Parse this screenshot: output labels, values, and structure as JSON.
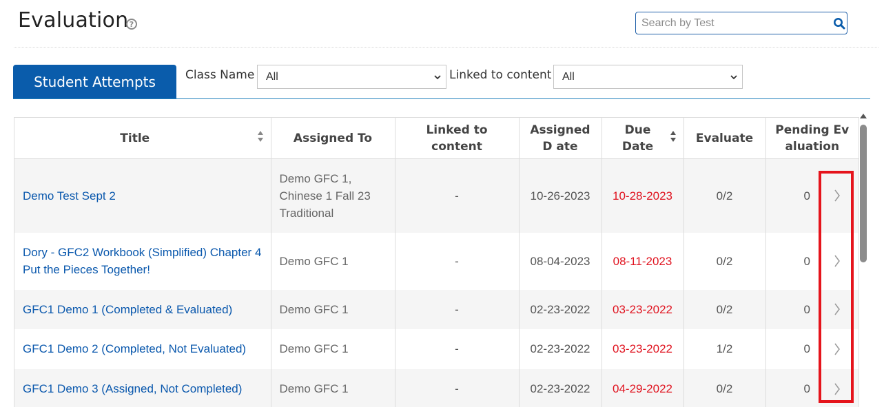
{
  "header": {
    "title": "Evaluation",
    "help_icon": "question-circle-icon",
    "help_glyph": "?"
  },
  "search": {
    "placeholder": "Search by Test",
    "value": "",
    "icon": "search-icon"
  },
  "tabs": [
    {
      "label": "Student Attempts",
      "active": true
    }
  ],
  "filters": {
    "class_name": {
      "label": "Class Name",
      "value": "All"
    },
    "linked_content": {
      "label": "Linked to content",
      "value": "All"
    }
  },
  "table": {
    "columns": [
      {
        "label": "Title",
        "sortable": true
      },
      {
        "label": "Assigned To",
        "sortable": false
      },
      {
        "label": "Linked to content",
        "sortable": false
      },
      {
        "label": "Assigned D ate",
        "sortable": false
      },
      {
        "label": "Due Date",
        "sortable": true
      },
      {
        "label": "Evaluate",
        "sortable": false
      },
      {
        "label": "Pending Ev aluation",
        "sortable": false
      }
    ],
    "rows": [
      {
        "title": "Demo Test Sept 2",
        "assigned_to": "Demo GFC 1, Chinese 1 Fall 23 Traditional",
        "linked": "-",
        "assigned_date": "10-26-2023",
        "due_date": "10-28-2023",
        "evaluate": "0/2",
        "pending": "0"
      },
      {
        "title": "Dory - GFC2 Workbook (Simplified) Chapter 4 Put the Pieces Together!",
        "assigned_to": "Demo GFC 1",
        "linked": "-",
        "assigned_date": "08-04-2023",
        "due_date": "08-11-2023",
        "evaluate": "0/2",
        "pending": "0"
      },
      {
        "title": "GFC1 Demo 1 (Completed & Evaluated)",
        "assigned_to": "Demo GFC 1",
        "linked": "-",
        "assigned_date": "02-23-2022",
        "due_date": "03-23-2022",
        "evaluate": "0/2",
        "pending": "0"
      },
      {
        "title": "GFC1 Demo 2 (Completed, Not Evaluated)",
        "assigned_to": "Demo GFC 1",
        "linked": "-",
        "assigned_date": "02-23-2022",
        "due_date": "03-23-2022",
        "evaluate": "1/2",
        "pending": "0"
      },
      {
        "title": "GFC1 Demo 3 (Assigned, Not Completed)",
        "assigned_to": "Demo GFC 1",
        "linked": "-",
        "assigned_date": "02-23-2022",
        "due_date": "04-29-2022",
        "evaluate": "0/2",
        "pending": "0"
      }
    ]
  },
  "colors": {
    "brand": "#0a5cab",
    "link": "#0a58ad",
    "due_date": "#e0131f",
    "highlight": "#e5141c"
  }
}
